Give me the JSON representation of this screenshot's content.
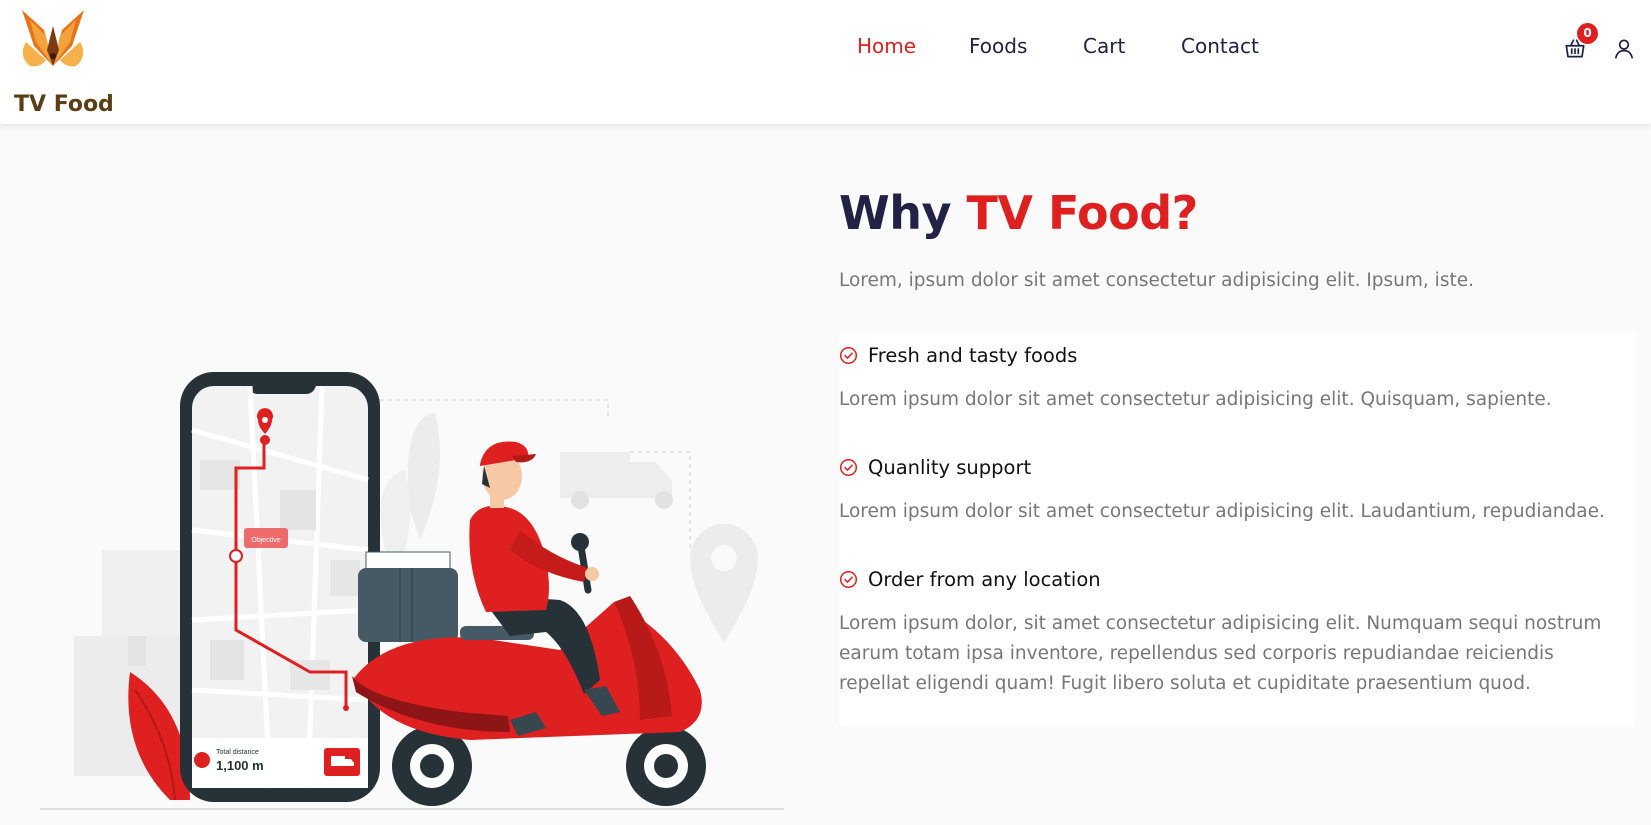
{
  "brand": {
    "name": "TV Food"
  },
  "nav": {
    "items": [
      {
        "label": "Home"
      },
      {
        "label": "Foods"
      },
      {
        "label": "Cart"
      },
      {
        "label": "Contact"
      }
    ]
  },
  "header": {
    "cart_count": "0"
  },
  "illustration": {
    "map_label": "Objective",
    "distance_caption": "Total distance",
    "distance_value": "1,100 m"
  },
  "section": {
    "title_part1": "Why",
    "title_part2": "TV Food?",
    "intro": "Lorem, ipsum dolor sit amet consectetur adipisicing elit. Ipsum, iste."
  },
  "features": [
    {
      "title": "Fresh and tasty foods",
      "description": "Lorem ipsum dolor sit amet consectetur adipisicing elit. Quisquam, sapiente."
    },
    {
      "title": "Quanlity support",
      "description": "Lorem ipsum dolor sit amet consectetur adipisicing elit. Laudantium, repudiandae."
    },
    {
      "title": "Order from any location",
      "description": "Lorem ipsum dolor, sit amet consectetur adipisicing elit. Numquam sequi nostrum earum totam ipsa inventore, repellendus sed corporis repudiandae reiciendis repellat eligendi quam! Fugit libero soluta et cupiditate praesentium quod."
    }
  ],
  "colors": {
    "accent": "#df2020",
    "heading": "#212245",
    "brand_text": "#5a3e14",
    "muted": "#777777"
  },
  "icons": {
    "cart": "shopping-basket-icon",
    "user": "user-icon",
    "feature": "checkmark-circle-icon"
  }
}
